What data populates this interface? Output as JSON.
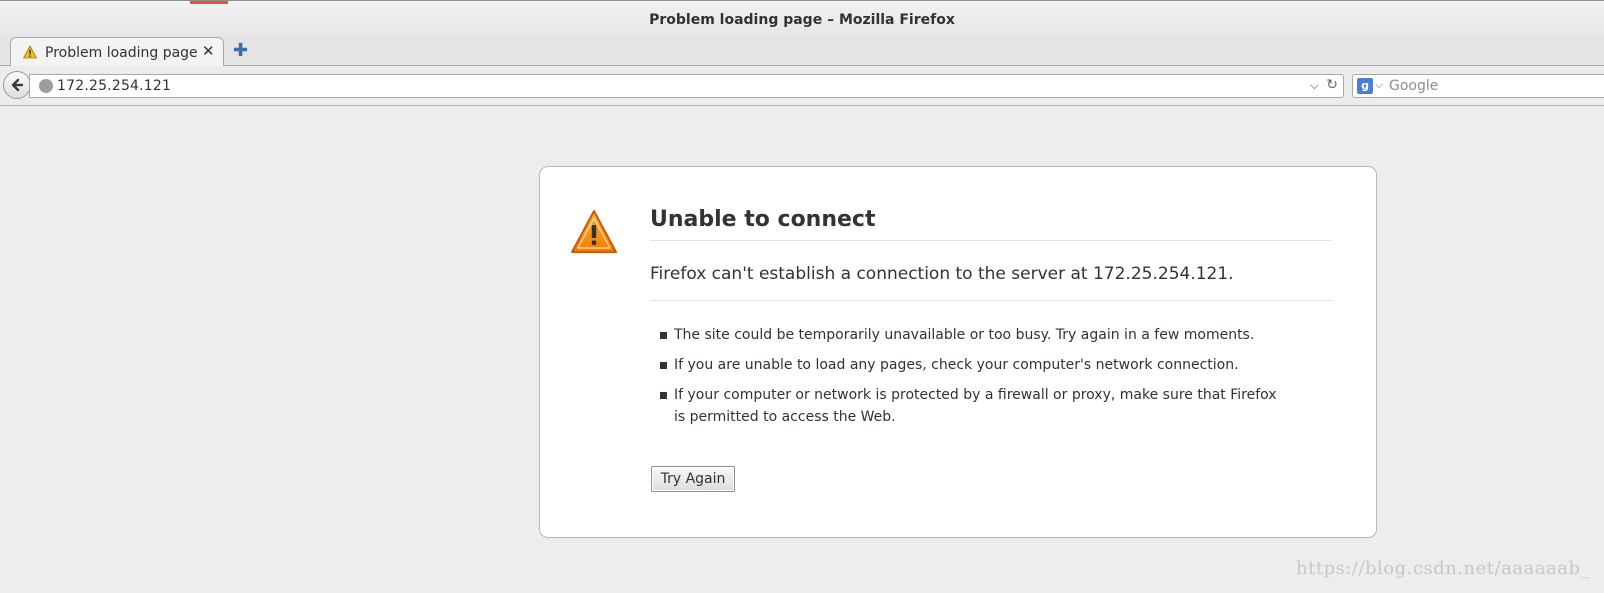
{
  "window": {
    "title": "Problem loading page – Mozilla Firefox"
  },
  "tabs": [
    {
      "label": "Problem loading page",
      "icon": "warning-icon",
      "close_icon": "close-icon",
      "active": true
    }
  ],
  "new_tab_icon": "plus-icon",
  "navbar": {
    "back_icon": "back-arrow-icon",
    "url": "172.25.254.121",
    "site_icon": "globe-icon",
    "dropmarker_icon": "chevron-down-icon",
    "reload_icon": "reload-icon",
    "search": {
      "engine_icon": "google-icon",
      "engine_letter": "g",
      "placeholder": "Google",
      "value": ""
    }
  },
  "error": {
    "icon": "warning-triangle-icon",
    "title": "Unable to connect",
    "description": "Firefox can't establish a connection to the server at 172.25.254.121.",
    "suggestions": [
      "The site could be temporarily unavailable or too busy. Try again in a few moments.",
      "If you are unable to load any pages, check your computer's network connection.",
      "If your computer or network is protected by a firewall or proxy, make sure that Firefox is permitted to access the Web."
    ],
    "try_again_label": "Try Again"
  },
  "watermark": "https://blog.csdn.net/aaaaaab_",
  "colors": {
    "warning_orange": "#f57900",
    "accent_blue": "#3b6ea8",
    "page_background": "#ededed"
  }
}
